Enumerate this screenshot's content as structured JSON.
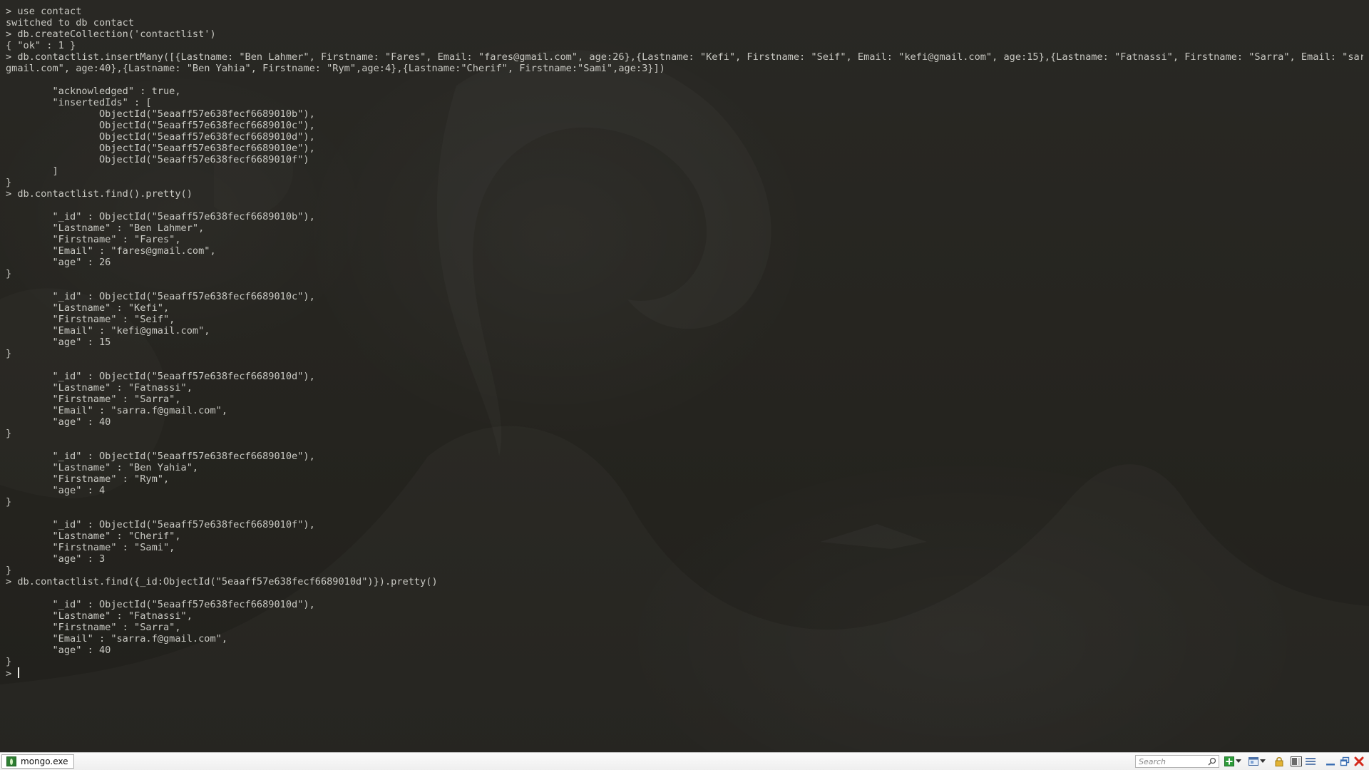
{
  "console": {
    "lines": [
      "> use contact",
      "switched to db contact",
      "> db.createCollection('contactlist')",
      "{ \"ok\" : 1 }",
      "> db.contactlist.insertMany([{Lastname: \"Ben Lahmer\", Firstname: \"Fares\", Email: \"fares@gmail.com\", age:26},{Lastname: \"Kefi\", Firstname: \"Seif\", Email: \"kefi@gmail.com\", age:15},{Lastname: \"Fatnassi\", Firstname: \"Sarra\", Email: \"sarra.f@",
      "gmail.com\", age:40},{Lastname: \"Ben Yahia\", Firstname: \"Rym\",age:4},{Lastname:\"Cherif\", Firstname:\"Sami\",age:3}])",
      "",
      "        \"acknowledged\" : true,",
      "        \"insertedIds\" : [",
      "                ObjectId(\"5eaaff57e638fecf6689010b\"),",
      "                ObjectId(\"5eaaff57e638fecf6689010c\"),",
      "                ObjectId(\"5eaaff57e638fecf6689010d\"),",
      "                ObjectId(\"5eaaff57e638fecf6689010e\"),",
      "                ObjectId(\"5eaaff57e638fecf6689010f\")",
      "        ]",
      "}",
      "> db.contactlist.find().pretty()",
      "",
      "        \"_id\" : ObjectId(\"5eaaff57e638fecf6689010b\"),",
      "        \"Lastname\" : \"Ben Lahmer\",",
      "        \"Firstname\" : \"Fares\",",
      "        \"Email\" : \"fares@gmail.com\",",
      "        \"age\" : 26",
      "}",
      "",
      "        \"_id\" : ObjectId(\"5eaaff57e638fecf6689010c\"),",
      "        \"Lastname\" : \"Kefi\",",
      "        \"Firstname\" : \"Seif\",",
      "        \"Email\" : \"kefi@gmail.com\",",
      "        \"age\" : 15",
      "}",
      "",
      "        \"_id\" : ObjectId(\"5eaaff57e638fecf6689010d\"),",
      "        \"Lastname\" : \"Fatnassi\",",
      "        \"Firstname\" : \"Sarra\",",
      "        \"Email\" : \"sarra.f@gmail.com\",",
      "        \"age\" : 40",
      "}",
      "",
      "        \"_id\" : ObjectId(\"5eaaff57e638fecf6689010e\"),",
      "        \"Lastname\" : \"Ben Yahia\",",
      "        \"Firstname\" : \"Rym\",",
      "        \"age\" : 4",
      "}",
      "",
      "        \"_id\" : ObjectId(\"5eaaff57e638fecf6689010f\"),",
      "        \"Lastname\" : \"Cherif\",",
      "        \"Firstname\" : \"Sami\",",
      "        \"age\" : 3",
      "}",
      "> db.contactlist.find({_id:ObjectId(\"5eaaff57e638fecf6689010d\")}).pretty()",
      "",
      "        \"_id\" : ObjectId(\"5eaaff57e638fecf6689010d\"),",
      "        \"Lastname\" : \"Fatnassi\",",
      "        \"Firstname\" : \"Sarra\",",
      "        \"Email\" : \"sarra.f@gmail.com\",",
      "        \"age\" : 40",
      "}"
    ],
    "prompt": "> "
  },
  "taskbar": {
    "task_label": "mongo.exe",
    "task_icon": "mongo-app-icon",
    "search_placeholder": "Search",
    "tray_icons": [
      "add-icon",
      "dropdown-icon",
      "window-icon",
      "dropdown-icon",
      "lock-icon",
      "layout-icon",
      "list-icon",
      "minimize-icon",
      "restore-icon",
      "close-icon"
    ]
  },
  "colors": {
    "console_text": "#c9c9c3",
    "background": "#262521",
    "taskbar": "#f4f4f4",
    "close_red": "#d42a1c",
    "add_green": "#2e9b3a"
  }
}
